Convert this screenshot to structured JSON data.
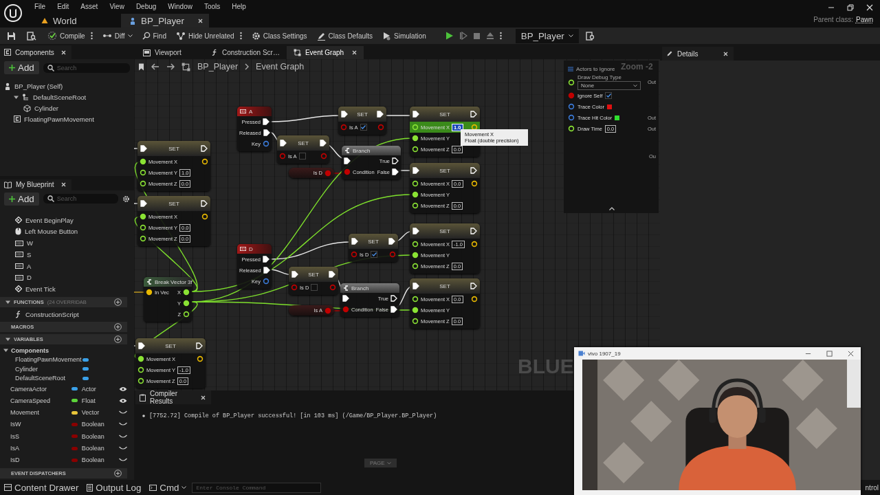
{
  "title_bar": {
    "menus": [
      "File",
      "Edit",
      "Asset",
      "View",
      "Debug",
      "Window",
      "Tools",
      "Help"
    ],
    "tabs": [
      {
        "label": "World",
        "kind": "level",
        "selected": false
      },
      {
        "label": "BP_Player",
        "kind": "blueprint",
        "selected": true
      }
    ],
    "parent_class_label": "Parent class:",
    "parent_class": "Pawn"
  },
  "toolbar": {
    "compile": "Compile",
    "diff": "Diff",
    "find": "Find",
    "hide_unrelated": "Hide Unrelated",
    "class_settings": "Class Settings",
    "class_defaults": "Class Defaults",
    "simulation": "Simulation",
    "debug_object": "BP_Player"
  },
  "components": {
    "title": "Components",
    "add": "Add",
    "search_placeholder": "Search",
    "tree": [
      {
        "label": "BP_Player (Self)",
        "kind": "self",
        "children": [
          {
            "label": "DefaultSceneRoot",
            "kind": "scene",
            "expanded": true,
            "children": [
              {
                "label": "Cylinder",
                "kind": "mesh"
              }
            ]
          },
          {
            "label": "FloatingPawnMovement",
            "kind": "component"
          }
        ]
      }
    ]
  },
  "my_blueprint": {
    "title": "My Blueprint",
    "add": "Add",
    "search_placeholder": "Search",
    "graph_items": [
      {
        "label": "Event BeginPlay",
        "kind": "event"
      },
      {
        "label": "Left Mouse Button",
        "kind": "mouse"
      },
      {
        "label": "W",
        "kind": "key"
      },
      {
        "label": "S",
        "kind": "key"
      },
      {
        "label": "A",
        "kind": "key"
      },
      {
        "label": "D",
        "kind": "key"
      },
      {
        "label": "Event Tick",
        "kind": "event"
      }
    ],
    "functions": {
      "label": "FUNCTIONS",
      "note": "(24 OVERRIDAB",
      "expanded": true,
      "items": [
        "ConstructionScript"
      ]
    },
    "macros": {
      "label": "MACROS"
    },
    "variables": {
      "label": "VARIABLES",
      "expanded": true,
      "category": "Components",
      "component_vars": [
        {
          "label": "FloatingPawnMovement",
          "color": "#3aa0e8"
        },
        {
          "label": "Cylinder",
          "color": "#3aa0e8"
        },
        {
          "label": "DefaultSceneRoot",
          "color": "#3aa0e8"
        }
      ],
      "vars": [
        {
          "label": "CameraActor",
          "type": "Actor",
          "color": "#3aa0e8",
          "public": true
        },
        {
          "label": "CameraSpeed",
          "type": "Float",
          "color": "#5cd43a",
          "public": true
        },
        {
          "label": "Movement",
          "type": "Vector",
          "color": "#e8c53a",
          "public": false
        },
        {
          "label": "IsW",
          "type": "Boolean",
          "color": "#8a0000",
          "public": false
        },
        {
          "label": "IsS",
          "type": "Boolean",
          "color": "#8a0000",
          "public": false
        },
        {
          "label": "IsA",
          "type": "Boolean",
          "color": "#8a0000",
          "public": false
        },
        {
          "label": "IsD",
          "type": "Boolean",
          "color": "#8a0000",
          "public": false
        }
      ]
    },
    "event_dispatchers": {
      "label": "EVENT DISPATCHERS"
    }
  },
  "graph_tabs": [
    {
      "label": "Viewport",
      "kind": "viewport",
      "selected": false
    },
    {
      "label": "Construction Scr…",
      "kind": "function",
      "selected": false
    },
    {
      "label": "Event Graph",
      "kind": "graph",
      "selected": true
    }
  ],
  "breadcrumb": [
    "BP_Player",
    "Event Graph"
  ],
  "graph": {
    "nodes": [
      {
        "kind": "set",
        "title": "SET",
        "exec_in": true,
        "exec_out": false,
        "inputs": [
          {
            "label": "Movement X",
            "kind": "float",
            "connected": true,
            "selected": false
          },
          {
            "label": "Movement Y",
            "kind": "float",
            "connected": false,
            "value": "1.0",
            "selected": false
          },
          {
            "label": "Movement Z",
            "kind": "float",
            "connected": false,
            "value": "0.0",
            "selected": false
          }
        ],
        "outputs": [
          {
            "kind": "vector",
            "connected": false
          }
        ]
      },
      {
        "kind": "set",
        "title": "SET",
        "exec_in": true,
        "exec_out": false,
        "inputs": [
          {
            "label": "Movement X",
            "kind": "float",
            "connected": true,
            "selected": false
          },
          {
            "label": "Movement Y",
            "kind": "float",
            "connected": false,
            "value": "0.0",
            "selected": false
          },
          {
            "label": "Movement Z",
            "kind": "float",
            "connected": false,
            "value": "0.0",
            "selected": false
          }
        ],
        "outputs": [
          {
            "kind": "vector",
            "connected": false
          }
        ]
      },
      {
        "kind": "key_event",
        "title": "A",
        "outputs": [
          {
            "label": "Pressed",
            "kind": "exec",
            "connected": true
          },
          {
            "label": "Released",
            "kind": "exec",
            "connected": true
          },
          {
            "label": "Key",
            "kind": "key",
            "connected": false
          }
        ]
      },
      {
        "kind": "set",
        "title": "SET",
        "exec_in": true,
        "exec_out": true,
        "inputs": [
          {
            "label": "Is A",
            "kind": "bool",
            "connected": false,
            "checked": true
          }
        ],
        "outputs": [
          {
            "kind": "bool",
            "connected": false
          }
        ]
      },
      {
        "kind": "set",
        "title": "SET",
        "exec_in": true,
        "exec_out": true,
        "inputs": [
          {
            "label": "Is A",
            "kind": "bool",
            "connected": false,
            "checked": false
          }
        ],
        "outputs": [
          {
            "kind": "bool",
            "connected": false
          }
        ]
      },
      {
        "kind": "getter",
        "outputs": [
          {
            "label": "Is D",
            "kind": "bool",
            "connected": true
          }
        ]
      },
      {
        "kind": "branch",
        "title": "Branch",
        "inputs": [
          {
            "kind": "exec",
            "connected": true
          },
          {
            "label": "Condition",
            "kind": "bool",
            "connected": true
          }
        ],
        "outputs": [
          {
            "label": "True",
            "kind": "exec",
            "connected": false
          },
          {
            "label": "False",
            "kind": "exec",
            "connected": true
          }
        ]
      },
      {
        "kind": "set",
        "title": "SET",
        "exec_in": true,
        "exec_out": false,
        "inputs": [
          {
            "label": "Movement X",
            "kind": "float",
            "connected": false,
            "value": "1.0",
            "selected": true
          },
          {
            "label": "Movement Y",
            "kind": "float",
            "connected": true,
            "selected": false
          },
          {
            "label": "Movement Z",
            "kind": "float",
            "connected": false,
            "value": "0.0",
            "selected": false
          }
        ],
        "outputs": [
          {
            "kind": "vector",
            "connected": false
          }
        ]
      },
      {
        "kind": "set",
        "title": "SET",
        "exec_in": true,
        "exec_out": false,
        "inputs": [
          {
            "label": "Movement X",
            "kind": "float",
            "connected": false,
            "value": "0.0",
            "selected": false
          },
          {
            "label": "Movement Y",
            "kind": "float",
            "connected": true,
            "selected": false
          },
          {
            "label": "Movement Z",
            "kind": "float",
            "connected": false,
            "value": "0.0",
            "selected": false
          }
        ],
        "outputs": [
          {
            "kind": "vector",
            "connected": false
          }
        ]
      },
      {
        "kind": "key_event",
        "title": "D",
        "outputs": [
          {
            "label": "Pressed",
            "kind": "exec",
            "connected": true
          },
          {
            "label": "Released",
            "kind": "exec",
            "connected": true
          },
          {
            "label": "Key",
            "kind": "key",
            "connected": false
          }
        ]
      },
      {
        "kind": "set",
        "title": "SET",
        "exec_in": true,
        "exec_out": true,
        "inputs": [
          {
            "label": "Is D",
            "kind": "bool",
            "connected": false,
            "checked": true
          }
        ],
        "outputs": [
          {
            "kind": "bool",
            "connected": false
          }
        ]
      },
      {
        "kind": "set",
        "title": "SET",
        "exec_in": true,
        "exec_out": true,
        "inputs": [
          {
            "label": "Is D",
            "kind": "bool",
            "connected": false,
            "checked": false
          }
        ],
        "outputs": [
          {
            "kind": "bool",
            "connected": false
          }
        ]
      },
      {
        "kind": "break_vector",
        "title": "Break Vector 3f",
        "inputs": [
          {
            "label": "In Vec",
            "kind": "vector",
            "connected": true
          }
        ],
        "outputs": [
          {
            "label": "X",
            "kind": "float",
            "connected": true
          },
          {
            "label": "Y",
            "kind": "float",
            "connected": true
          },
          {
            "label": "Z",
            "kind": "float",
            "connected": false
          }
        ]
      },
      {
        "kind": "getter",
        "outputs": [
          {
            "label": "Is A",
            "kind": "bool",
            "connected": true
          }
        ]
      },
      {
        "kind": "branch",
        "title": "Branch",
        "inputs": [
          {
            "kind": "exec",
            "connected": true
          },
          {
            "label": "Condition",
            "kind": "bool",
            "connected": true
          }
        ],
        "outputs": [
          {
            "label": "True",
            "kind": "exec",
            "connected": false
          },
          {
            "label": "False",
            "kind": "exec",
            "connected": true
          }
        ]
      },
      {
        "kind": "set",
        "title": "SET",
        "exec_in": true,
        "exec_out": false,
        "inputs": [
          {
            "label": "Movement X",
            "kind": "float",
            "connected": false,
            "value": "-1.0",
            "selected": false
          },
          {
            "label": "Movement Y",
            "kind": "float",
            "connected": true,
            "selected": false
          },
          {
            "label": "Movement Z",
            "kind": "float",
            "connected": false,
            "value": "0.0",
            "selected": false
          }
        ],
        "outputs": [
          {
            "kind": "vector",
            "connected": false
          }
        ]
      },
      {
        "kind": "set",
        "title": "SET",
        "exec_in": true,
        "exec_out": false,
        "inputs": [
          {
            "label": "Movement X",
            "kind": "float",
            "connected": false,
            "value": "0.0",
            "selected": false
          },
          {
            "label": "Movement Y",
            "kind": "float",
            "connected": true,
            "selected": false
          },
          {
            "label": "Movement Z",
            "kind": "float",
            "connected": false,
            "value": "0.0",
            "selected": false
          }
        ],
        "outputs": [
          {
            "kind": "vector",
            "connected": false
          }
        ]
      },
      {
        "kind": "set",
        "title": "SET",
        "exec_in": true,
        "exec_out": false,
        "inputs": [
          {
            "label": "Movement X",
            "kind": "float",
            "connected": true,
            "selected": false
          },
          {
            "label": "Movement Y",
            "kind": "float",
            "connected": false,
            "value": "-1.0",
            "selected": false
          },
          {
            "label": "Movement Z",
            "kind": "float",
            "connected": false,
            "value": "0.0",
            "selected": false
          }
        ],
        "outputs": [
          {
            "kind": "vector",
            "connected": false
          }
        ]
      }
    ],
    "trace_panel": {
      "actors_label": "Actors to Ignore",
      "debug_type_label": "Draw Debug Type",
      "debug_type": "None",
      "ignore_self": {
        "label": "Ignore Self",
        "checked": true
      },
      "trace_color": {
        "label": "Trace Color",
        "color": "#e01010"
      },
      "trace_hit_color": {
        "label": "Trace Hit Color",
        "color": "#30e030"
      },
      "draw_time": {
        "label": "Draw Time",
        "value": "0.0"
      },
      "outputs": [
        "Out",
        "Out",
        "Out",
        "Ou"
      ]
    },
    "zoom_label": "Zoom -2",
    "watermark": "BLUE",
    "tooltip": {
      "title": "Movement X",
      "subtitle": "Float (double precision)"
    }
  },
  "compiler_results": {
    "title": "Compiler Results",
    "messages": [
      "[7752.72] Compile of BP_Player successful! [in 103 ms] (/Game/BP_Player.BP_Player)"
    ],
    "page": "PAGE"
  },
  "details": {
    "title": "Details"
  },
  "status_bar": {
    "content_drawer": "Content Drawer",
    "output_log": "Output Log",
    "cmd": "Cmd",
    "console_placeholder": "Enter Console Command",
    "right_text": "ntrol"
  },
  "webcam": {
    "title": "vivo 1907_19"
  }
}
